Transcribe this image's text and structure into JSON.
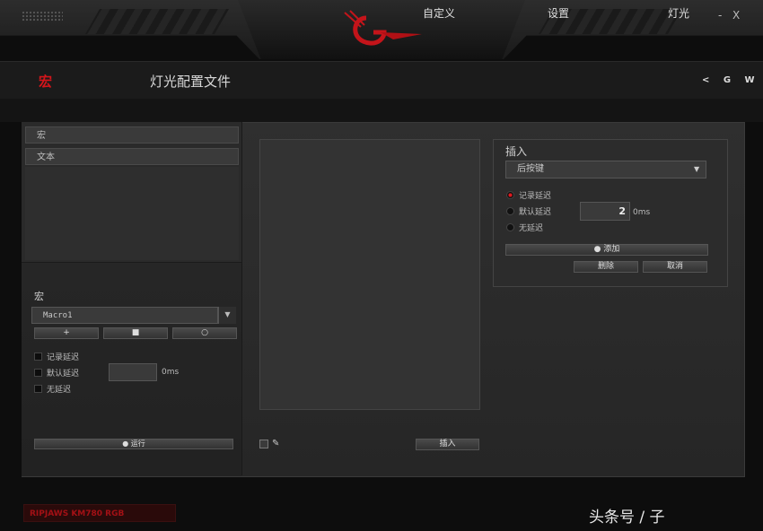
{
  "window": {
    "close_label": "X",
    "minimize_label": "-"
  },
  "header": {
    "brand_mark": "宏",
    "profile_title": "灯光配置文件",
    "icons_text": "< G W"
  },
  "tabs": [
    "自定义",
    "设置",
    "灯光"
  ],
  "left_list": {
    "items": [
      "宏",
      "文本"
    ]
  },
  "macro": {
    "section_label": "宏",
    "selected": "Macro1",
    "add_label": "+",
    "stop_label": "■",
    "record_label": "○",
    "options": [
      "记录延迟",
      "默认延迟",
      "无延迟"
    ],
    "delay_unit": "0ms",
    "run_label": "● 运行"
  },
  "canvas_footer": {
    "insert_label": "插入"
  },
  "insert": {
    "title": "插入",
    "dropdown_value": "后按键",
    "options": [
      "记录延迟",
      "默认延迟",
      "无延迟"
    ],
    "selected_option": 0,
    "delay_value": "2",
    "delay_unit": "0ms",
    "add_label": "● 添加",
    "delete_label": "删除",
    "cancel_label": "取消"
  },
  "footer": {
    "model": "RIPJAWS KM780 RGB",
    "watermark": "头条号 / 子"
  },
  "colors": {
    "accent": "#d4151b",
    "panel": "#2a2a2a"
  }
}
